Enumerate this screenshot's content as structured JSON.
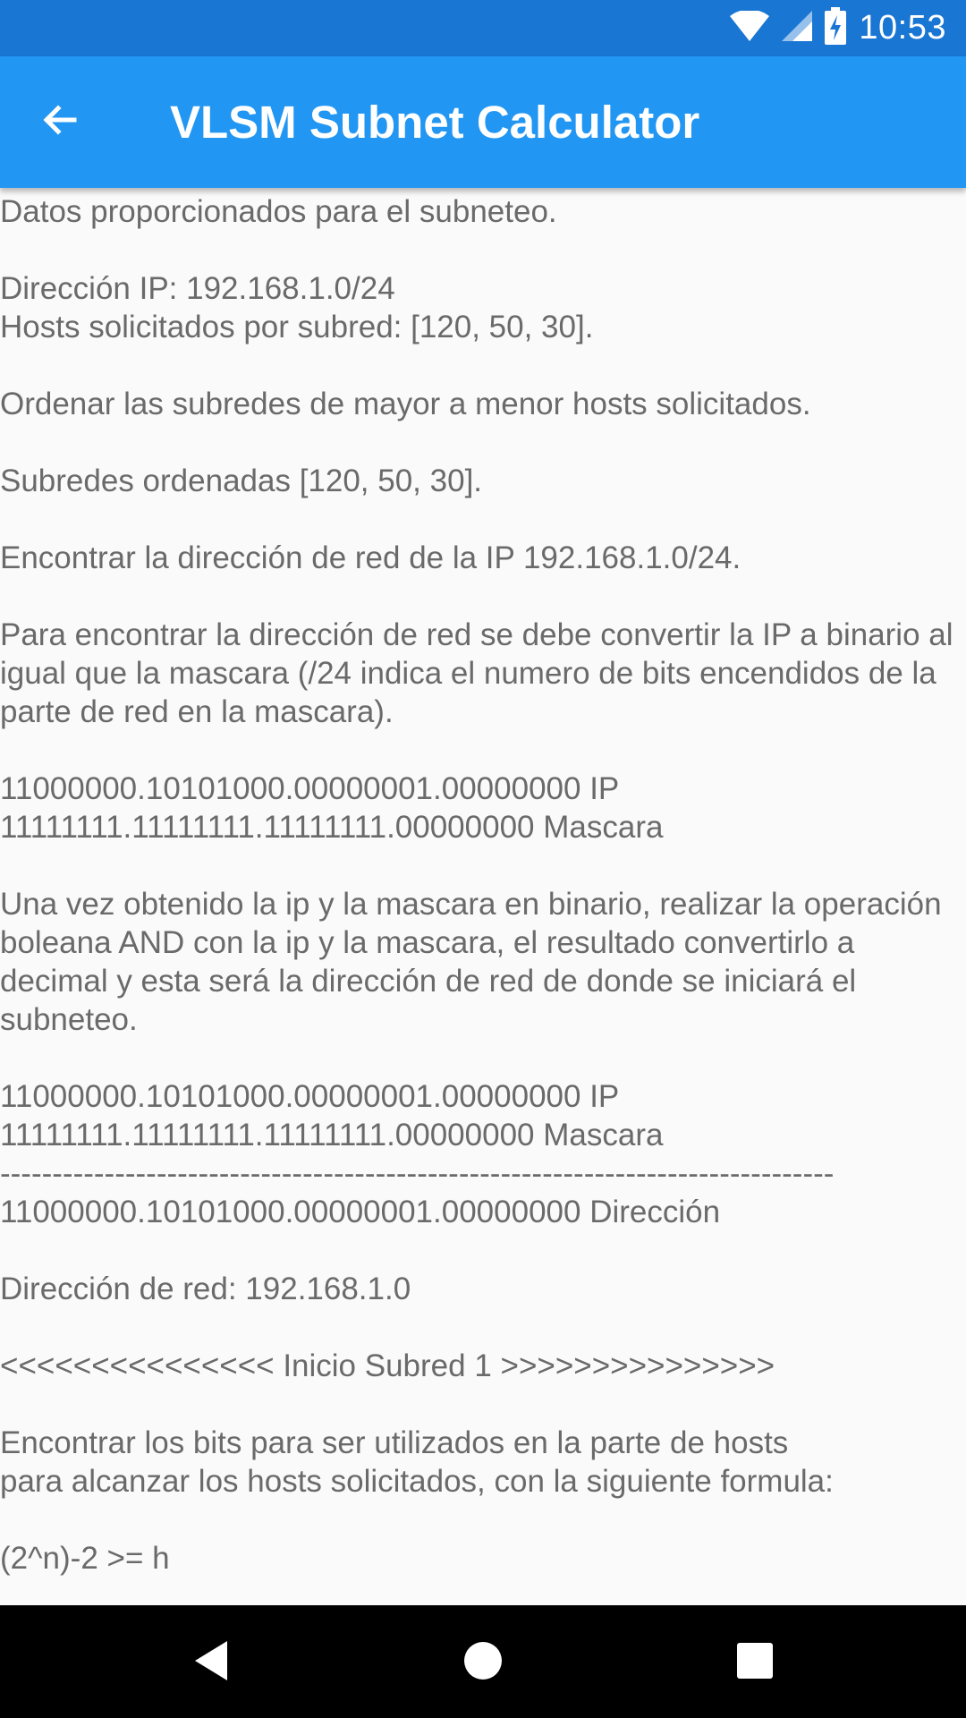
{
  "status_bar": {
    "time": "10:53",
    "icons": [
      "wifi-icon",
      "cell-signal-icon",
      "battery-charging-icon"
    ]
  },
  "app_bar": {
    "title": "VLSM Subnet Calculator",
    "back_icon": "arrow-back-icon"
  },
  "content": {
    "text": "Datos proporcionados para el subneteo.\n\nDirección IP: 192.168.1.0/24\nHosts solicitados por subred: [120, 50, 30].\n\nOrdenar las subredes de mayor a menor hosts solicitados.\n\nSubredes ordenadas [120, 50, 30].\n\nEncontrar la dirección de red de la IP 192.168.1.0/24.\n\nPara encontrar la dirección de red se debe convertir la IP a binario al igual que la mascara (/24 indica el numero de bits encendidos de la parte de red en la mascara).\n\n11000000.10101000.00000001.00000000 IP\n11111111.11111111.11111111.00000000 Mascara\n\nUna vez obtenido la ip y la mascara en binario, realizar la operación boleana AND con la ip y la mascara, el resultado convertirlo a decimal y esta será la dirección de red de donde se iniciará el subneteo.\n\n11000000.10101000.00000001.00000000 IP\n11111111.11111111.11111111.00000000 Mascara\n--------------------------------------------------------------------------------\n11000000.10101000.00000001.00000000 Dirección\n\nDirección de red: 192.168.1.0\n\n<<<<<<<<<<<<<<< Inicio Subred 1 >>>>>>>>>>>>>>>\n\nEncontrar los bits para ser utilizados en la parte de hosts\npara alcanzar los hosts solicitados, con la siguiente formula:\n\n(2^n)-2 >= h"
  },
  "nav_bar": {
    "icons": [
      "nav-back-icon",
      "nav-home-icon",
      "nav-recents-icon"
    ]
  },
  "colors": {
    "status_bar": "#1976D2",
    "app_bar": "#2196F3",
    "background": "#FAFAFA",
    "text": "#6A6A6A",
    "nav_bar": "#000000"
  }
}
